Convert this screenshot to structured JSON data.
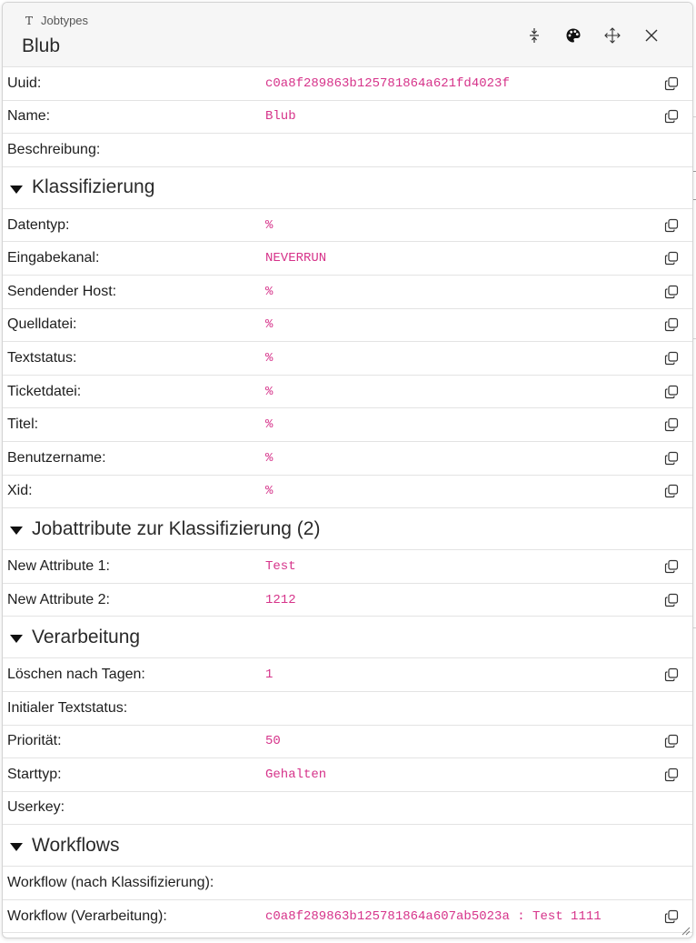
{
  "header": {
    "type_icon": "T",
    "type_label": "Jobtypes",
    "title": "Blub",
    "actions": [
      "expand-vertical-icon",
      "palette-icon",
      "move-icon",
      "close-icon"
    ]
  },
  "colors": {
    "value": "#d6338a",
    "header_bg": "#f6f6f6",
    "border": "#e3e3e3"
  },
  "basic": [
    {
      "label": "Uuid:",
      "value": "c0a8f289863b125781864a621fd4023f",
      "copy": true
    },
    {
      "label": "Name:",
      "value": "Blub",
      "copy": true
    },
    {
      "label": "Beschreibung:",
      "value": "",
      "copy": false
    }
  ],
  "sections": [
    {
      "label": "Klassifizierung",
      "rows": [
        {
          "label": "Datentyp:",
          "value": "%",
          "copy": true
        },
        {
          "label": "Eingabekanal:",
          "value": "NEVERRUN",
          "copy": true
        },
        {
          "label": "Sendender Host:",
          "value": "%",
          "copy": true
        },
        {
          "label": "Quelldatei:",
          "value": "%",
          "copy": true
        },
        {
          "label": "Textstatus:",
          "value": "%",
          "copy": true
        },
        {
          "label": "Ticketdatei:",
          "value": "%",
          "copy": true
        },
        {
          "label": "Titel:",
          "value": "%",
          "copy": true
        },
        {
          "label": "Benutzername:",
          "value": "%",
          "copy": true
        },
        {
          "label": "Xid:",
          "value": "%",
          "copy": true
        }
      ]
    },
    {
      "label": "Jobattribute zur Klassifizierung (2)",
      "rows": [
        {
          "label": "New Attribute 1:",
          "value": "Test",
          "copy": true
        },
        {
          "label": "New Attribute 2:",
          "value": "1212",
          "copy": true
        }
      ]
    },
    {
      "label": "Verarbeitung",
      "rows": [
        {
          "label": "Löschen nach Tagen:",
          "value": "1",
          "copy": true
        },
        {
          "label": "Initialer Textstatus:",
          "value": "",
          "copy": false
        },
        {
          "label": "Priorität:",
          "value": "50",
          "copy": true
        },
        {
          "label": "Starttyp:",
          "value": "Gehalten",
          "copy": true
        },
        {
          "label": "Userkey:",
          "value": "",
          "copy": false
        }
      ]
    },
    {
      "label": "Workflows",
      "rows": [
        {
          "label": "Workflow (nach Klassifizierung):",
          "value": "",
          "copy": false
        },
        {
          "label": "Workflow (Verarbeitung):",
          "value": "c0a8f289863b125781864a607ab5023a : Test 1111",
          "copy": true
        }
      ]
    }
  ]
}
